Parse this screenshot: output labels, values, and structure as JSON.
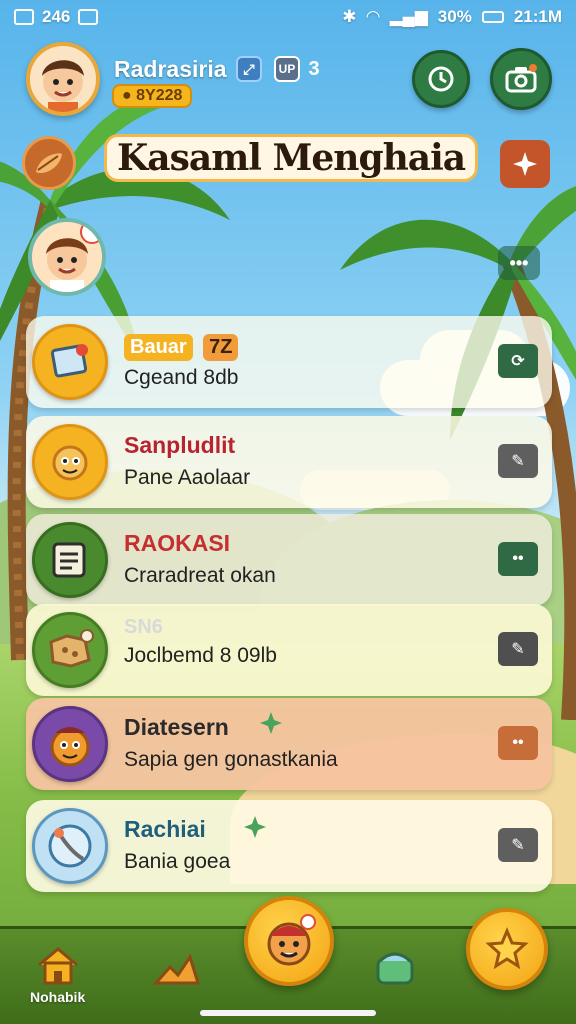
{
  "status_bar": {
    "left_text": "246",
    "battery": "30%",
    "time": "21:1M"
  },
  "header": {
    "username": "Radrasiria",
    "badge_label": "UP",
    "badge_count": "3",
    "coins": "8Y228",
    "title": "Kasaml Menghaia"
  },
  "list": {
    "items": [
      {
        "title": "Bauar",
        "tag": "7Z",
        "subtitle": "Cgeand 8db",
        "title_color": "#2b2b2b",
        "bg": "rgba(255,252,238,0.78)",
        "icon": "map-icon",
        "action_icon": "refresh-icon"
      },
      {
        "title": "Sanpludlit",
        "subtitle": "Pane Aaolaar",
        "title_color": "#b8232f",
        "bg": "rgba(255,250,230,0.85)",
        "icon": "character-icon",
        "action_icon": "edit-icon"
      },
      {
        "title": "RAOKASI",
        "subtitle": "Craradreat okan",
        "title_color": "#c52f2f",
        "bg": "rgba(240,236,220,0.82)",
        "icon": "notes-icon",
        "action_icon": "more-icon"
      },
      {
        "title": "SN6",
        "subtitle": "Joclbemd 8 09lb",
        "title_color": "#d9d9d9",
        "bg": "rgba(252,248,212,0.92)",
        "icon": "treasure-map-icon",
        "action_icon": "edit-icon"
      },
      {
        "title": "Diatesern",
        "subtitle": "Sapia gen gonastkania",
        "title_color": "#2b2b2b",
        "bg": "rgba(245,196,160,0.95)",
        "icon": "monster-icon",
        "action_icon": "more-icon"
      },
      {
        "title": "Rachiai",
        "subtitle": "Bania goea",
        "title_color": "#1f5f7a",
        "bg": "rgba(255,251,228,0.9)",
        "icon": "globe-icon",
        "action_icon": "edit-icon"
      }
    ]
  },
  "bottom_nav": {
    "home_label": "Nohabik"
  },
  "colors": {
    "accent": "#f5a815",
    "nav_green": "#4f7f24",
    "action_green": "#2f6a45"
  }
}
